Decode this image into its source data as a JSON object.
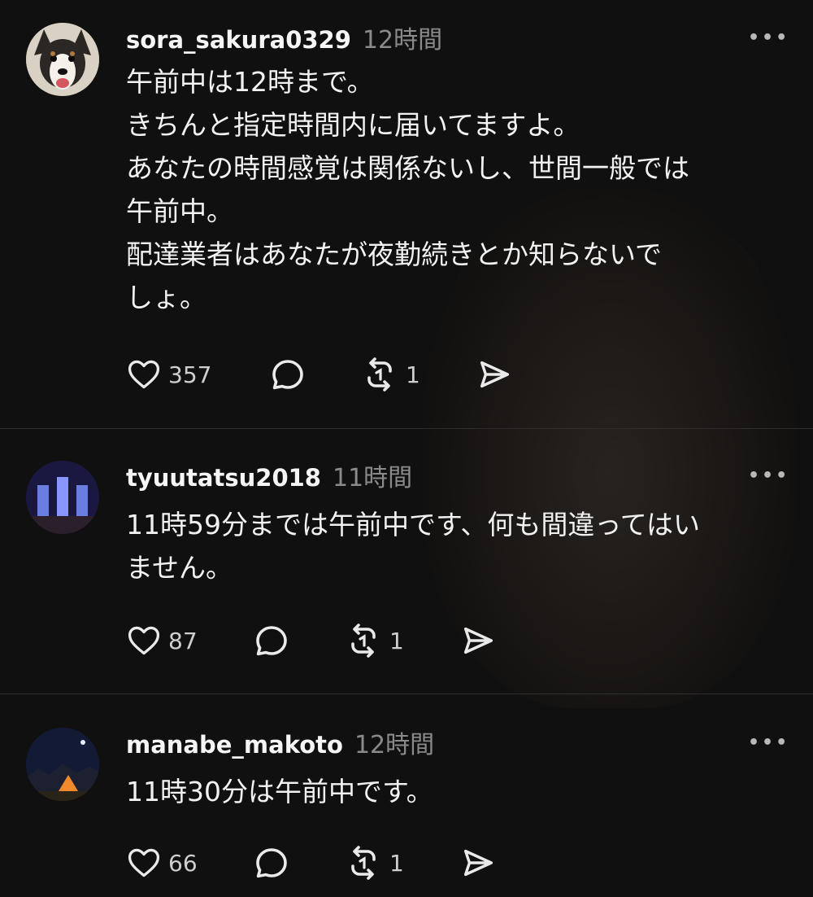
{
  "posts": [
    {
      "username": "sora_sakura0329",
      "time": "12時間",
      "lines": [
        "午前中は12時まで。",
        "きちんと指定時間内に届いてますよ。",
        "あなたの時間感覚は関係ないし、世間一般では",
        "午前中。",
        "配達業者はあなたが夜勤続きとか知らないで",
        "しょ。"
      ],
      "likes": "357",
      "reposts": "1"
    },
    {
      "username": "tyuutatsu2018",
      "time": "11時間",
      "lines": [
        "11時59分までは午前中です、何も間違ってはい",
        "ません。"
      ],
      "likes": "87",
      "reposts": "1"
    },
    {
      "username": "manabe_makoto",
      "time": "12時間",
      "lines": [
        "11時30分は午前中です。"
      ],
      "likes": "66",
      "reposts": "1"
    }
  ],
  "icons": {
    "like": "heart-icon",
    "comment": "comment-icon",
    "repost": "repost-icon",
    "share": "send-icon",
    "more": "more-icon"
  },
  "colors": {
    "background": "#101010",
    "text": "#f2f2f2",
    "muted": "#8a8a8a",
    "divider": "#2d2d2d"
  }
}
